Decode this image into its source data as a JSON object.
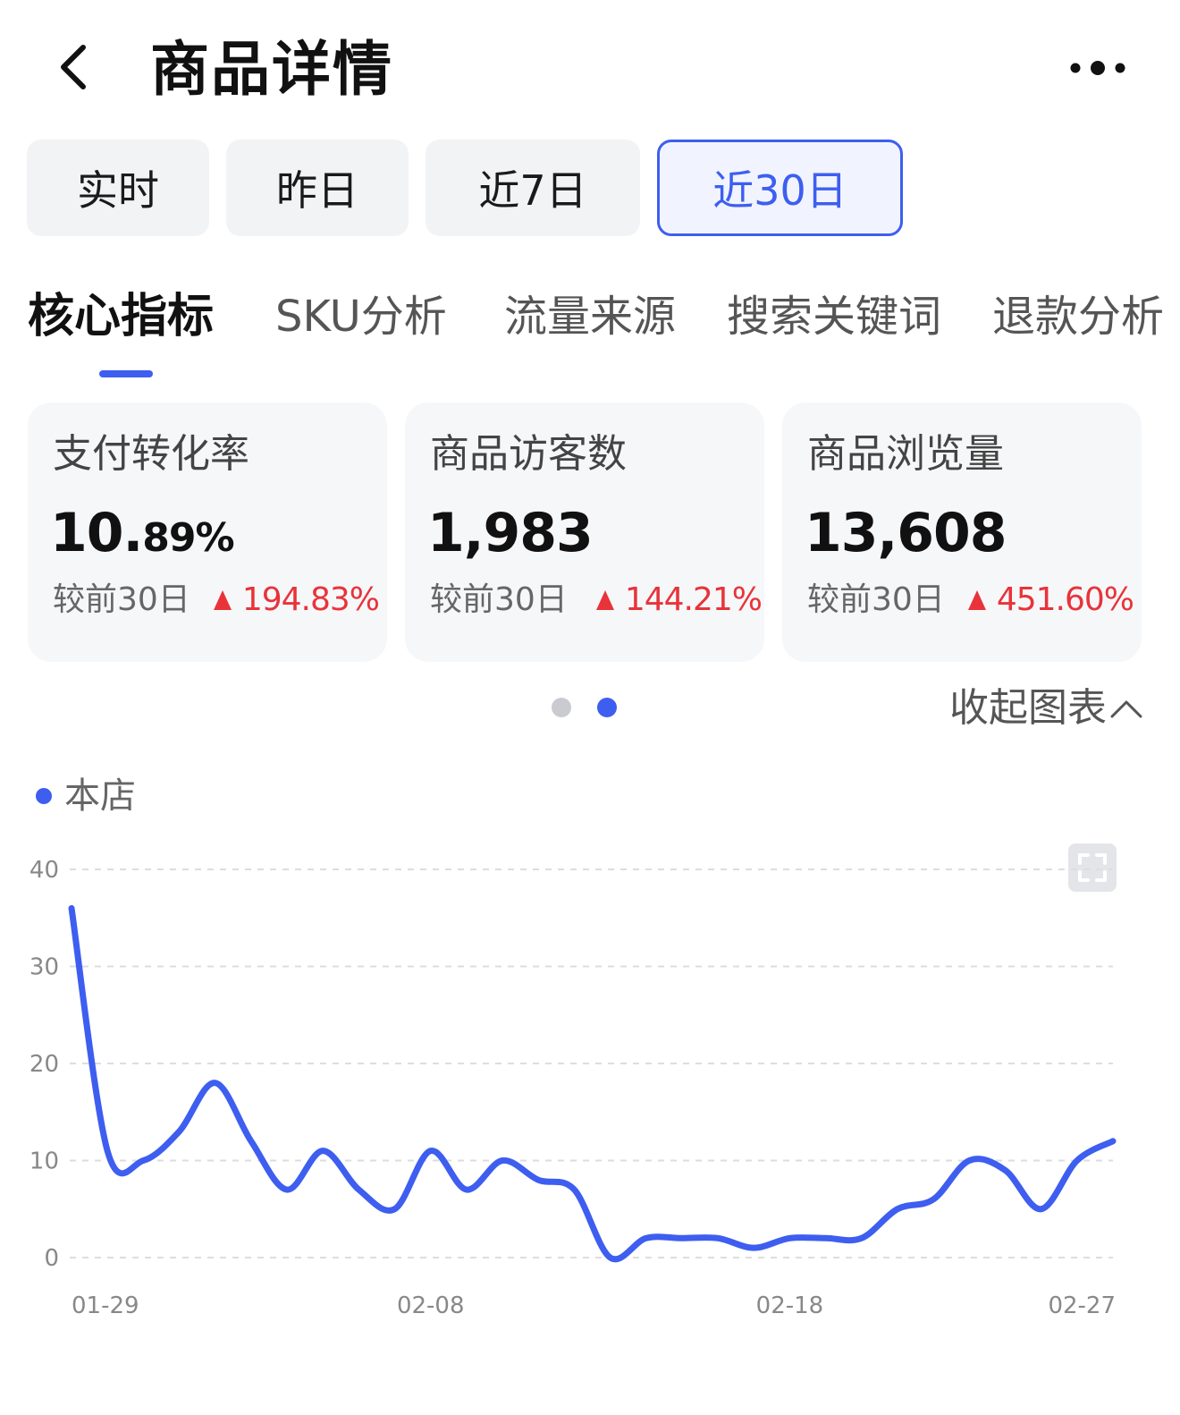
{
  "header": {
    "title": "商品详情",
    "back_icon": "chevron-left-icon",
    "more_icon": "more-dots-icon"
  },
  "period_tabs": [
    {
      "label": "实时",
      "active": false
    },
    {
      "label": "昨日",
      "active": false
    },
    {
      "label": "近7日",
      "active": false
    },
    {
      "label": "近30日",
      "active": true
    }
  ],
  "section_tabs": [
    {
      "label": "核心指标",
      "active": true
    },
    {
      "label": "SKU分析",
      "active": false
    },
    {
      "label": "流量来源",
      "active": false
    },
    {
      "label": "搜索关键词",
      "active": false
    },
    {
      "label": "退款分析",
      "active": false
    }
  ],
  "metrics": [
    {
      "label": "支付转化率",
      "value_main": "10.",
      "value_small": "89%",
      "compare_label": "较前30日",
      "change": "194.83%"
    },
    {
      "label": "商品访客数",
      "value_main": "1,983",
      "value_small": "",
      "compare_label": "较前30日",
      "change": "144.21%"
    },
    {
      "label": "商品浏览量",
      "value_main": "13,608",
      "value_small": "",
      "compare_label": "较前30日",
      "change": "451.60%"
    }
  ],
  "pager": {
    "count": 2,
    "active_index": 1
  },
  "collapse_label": "收起图表",
  "colors": {
    "accent": "#3e5ef0",
    "up": "#e8333a",
    "pager_inactive": "#c9cbd0"
  },
  "chart_data": {
    "type": "line",
    "series": [
      {
        "name": "本店",
        "x": [
          "01-29",
          "01-30",
          "01-31",
          "02-01",
          "02-02",
          "02-03",
          "02-04",
          "02-05",
          "02-06",
          "02-07",
          "02-08",
          "02-09",
          "02-10",
          "02-11",
          "02-12",
          "02-13",
          "02-14",
          "02-15",
          "02-16",
          "02-17",
          "02-18",
          "02-19",
          "02-20",
          "02-21",
          "02-22",
          "02-23",
          "02-24",
          "02-25",
          "02-26",
          "02-27"
        ],
        "values": [
          36,
          11,
          10,
          13,
          18,
          12,
          7,
          11,
          7,
          5,
          11,
          7,
          10,
          8,
          7,
          0,
          2,
          2,
          2,
          1,
          2,
          2,
          2,
          5,
          6,
          10,
          9,
          5,
          10,
          12
        ]
      }
    ],
    "x_tick_labels": [
      "01-29",
      "02-08",
      "02-18",
      "02-27"
    ],
    "y_ticks": [
      0,
      10,
      20,
      30,
      40
    ],
    "ylim": [
      0,
      40
    ],
    "grid": "horizontal-dashed",
    "legend_position": "top-left"
  }
}
